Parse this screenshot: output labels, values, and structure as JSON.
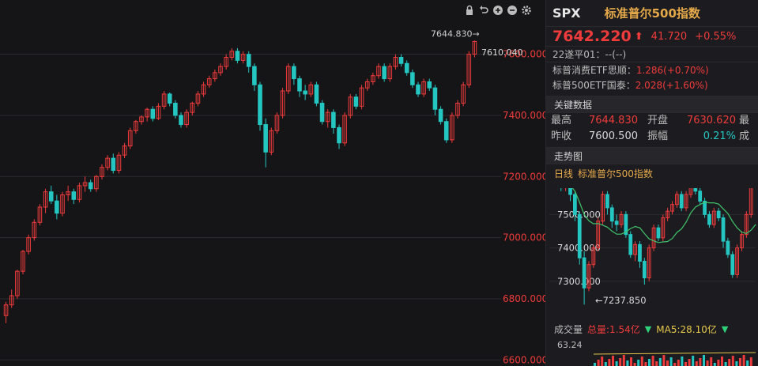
{
  "toolbar": {
    "icons": [
      "lock-icon",
      "undo-icon",
      "zoom-in-icon",
      "zoom-out-icon",
      "gear-icon"
    ]
  },
  "colors": {
    "up": "#ef3b3b",
    "down": "#25c6c1",
    "axis_text": "#ef3b3b",
    "grid": "#2c2c30",
    "ma": "#3fc46a",
    "accent": "#e6a94a"
  },
  "chart_data": [
    {
      "type": "candlestick",
      "yticks": [
        "7600.000",
        "7400.000",
        "7200.000",
        "7000.000",
        "6800.000",
        "6600.000"
      ],
      "ylim": [
        6580,
        7700
      ],
      "tick_values": [
        7600,
        7400,
        7200,
        7000,
        6800,
        6600
      ],
      "annotations": {
        "high_label": "7644.830",
        "last_label": "7610.040"
      },
      "candles": [
        [
          6745,
          6780,
          6720,
          6790
        ],
        [
          6780,
          6810,
          6770,
          6830
        ],
        [
          6810,
          6890,
          6800,
          6895
        ],
        [
          6890,
          6955,
          6880,
          6960
        ],
        [
          6955,
          7000,
          6945,
          7010
        ],
        [
          7000,
          7050,
          6990,
          7060
        ],
        [
          7050,
          7100,
          7040,
          7110
        ],
        [
          7100,
          7150,
          7080,
          7160
        ],
        [
          7150,
          7120,
          7110,
          7170
        ],
        [
          7120,
          7080,
          7060,
          7140
        ],
        [
          7080,
          7140,
          7070,
          7150
        ],
        [
          7140,
          7150,
          7120,
          7170
        ],
        [
          7150,
          7125,
          7110,
          7160
        ],
        [
          7125,
          7170,
          7115,
          7180
        ],
        [
          7170,
          7180,
          7150,
          7200
        ],
        [
          7180,
          7160,
          7150,
          7190
        ],
        [
          7160,
          7200,
          7150,
          7205
        ],
        [
          7200,
          7230,
          7190,
          7240
        ],
        [
          7230,
          7260,
          7220,
          7270
        ],
        [
          7260,
          7220,
          7210,
          7275
        ],
        [
          7220,
          7270,
          7210,
          7280
        ],
        [
          7270,
          7300,
          7260,
          7310
        ],
        [
          7300,
          7350,
          7290,
          7360
        ],
        [
          7350,
          7380,
          7340,
          7385
        ],
        [
          7380,
          7395,
          7370,
          7400
        ],
        [
          7395,
          7420,
          7380,
          7425
        ],
        [
          7420,
          7390,
          7380,
          7430
        ],
        [
          7390,
          7430,
          7385,
          7440
        ],
        [
          7430,
          7470,
          7420,
          7480
        ],
        [
          7470,
          7440,
          7430,
          7475
        ],
        [
          7440,
          7400,
          7390,
          7450
        ],
        [
          7400,
          7370,
          7360,
          7410
        ],
        [
          7370,
          7410,
          7360,
          7420
        ],
        [
          7410,
          7440,
          7400,
          7445
        ],
        [
          7440,
          7470,
          7430,
          7480
        ],
        [
          7470,
          7500,
          7460,
          7510
        ],
        [
          7500,
          7520,
          7490,
          7530
        ],
        [
          7520,
          7540,
          7510,
          7550
        ],
        [
          7540,
          7560,
          7530,
          7570
        ],
        [
          7560,
          7590,
          7550,
          7600
        ],
        [
          7590,
          7610,
          7580,
          7620
        ],
        [
          7610,
          7580,
          7570,
          7620
        ],
        [
          7580,
          7600,
          7570,
          7610
        ],
        [
          7600,
          7560,
          7540,
          7610
        ],
        [
          7560,
          7500,
          7480,
          7570
        ],
        [
          7500,
          7370,
          7350,
          7510
        ],
        [
          7370,
          7280,
          7230,
          7390
        ],
        [
          7280,
          7350,
          7270,
          7360
        ],
        [
          7350,
          7400,
          7340,
          7410
        ],
        [
          7400,
          7480,
          7390,
          7490
        ],
        [
          7480,
          7560,
          7470,
          7570
        ],
        [
          7560,
          7520,
          7500,
          7570
        ],
        [
          7520,
          7480,
          7460,
          7530
        ],
        [
          7480,
          7470,
          7450,
          7500
        ],
        [
          7470,
          7500,
          7460,
          7510
        ],
        [
          7500,
          7440,
          7430,
          7510
        ],
        [
          7440,
          7380,
          7370,
          7450
        ],
        [
          7380,
          7410,
          7360,
          7420
        ],
        [
          7410,
          7360,
          7340,
          7420
        ],
        [
          7360,
          7310,
          7290,
          7370
        ],
        [
          7310,
          7400,
          7300,
          7410
        ],
        [
          7400,
          7460,
          7390,
          7470
        ],
        [
          7460,
          7430,
          7420,
          7470
        ],
        [
          7430,
          7490,
          7420,
          7500
        ],
        [
          7490,
          7510,
          7480,
          7520
        ],
        [
          7510,
          7530,
          7500,
          7540
        ],
        [
          7530,
          7560,
          7520,
          7570
        ],
        [
          7560,
          7520,
          7510,
          7570
        ],
        [
          7520,
          7560,
          7510,
          7570
        ],
        [
          7560,
          7590,
          7550,
          7600
        ],
        [
          7590,
          7570,
          7560,
          7600
        ],
        [
          7570,
          7540,
          7530,
          7580
        ],
        [
          7540,
          7500,
          7490,
          7550
        ],
        [
          7500,
          7470,
          7460,
          7510
        ],
        [
          7470,
          7510,
          7460,
          7520
        ],
        [
          7510,
          7490,
          7480,
          7520
        ],
        [
          7490,
          7420,
          7400,
          7500
        ],
        [
          7420,
          7380,
          7370,
          7430
        ],
        [
          7380,
          7320,
          7310,
          7390
        ],
        [
          7320,
          7400,
          7310,
          7410
        ],
        [
          7400,
          7440,
          7390,
          7450
        ],
        [
          7440,
          7500,
          7430,
          7510
        ],
        [
          7500,
          7600,
          7490,
          7610
        ],
        [
          7600,
          7642,
          7590,
          7645
        ]
      ]
    },
    {
      "type": "candlestick",
      "title": "标准普尔500指数",
      "yticks": [
        "7500.000",
        "7400.000",
        "7300.000"
      ],
      "tick_values": [
        7500,
        7400,
        7300
      ],
      "ylim": [
        7200,
        7560
      ],
      "annotations": {
        "low_label": "←7237.850"
      }
    }
  ],
  "header": {
    "code": "SPX",
    "name": "标准普尔500指数"
  },
  "quote": {
    "price": "7642.220",
    "arrow": "⬆",
    "change": "41.720",
    "change_pct": "+0.55%"
  },
  "lines": {
    "l1": "22遂平01：--(--)",
    "l2_label": "标普消费ETF思顺：",
    "l2_val": "1.286(+0.70%)",
    "l3_label": "标普500ETF国泰：",
    "l3_val": "2.028(+1.60%)"
  },
  "key_data": {
    "title": "关键数据",
    "rows": [
      {
        "k1": "最高",
        "v1": "7644.830",
        "k2": "开盘",
        "v2": "7630.620",
        "k3": "最"
      },
      {
        "k1": "昨收",
        "v1": "7600.500",
        "k2": "振幅",
        "v2": "0.21%",
        "k3": "成"
      }
    ]
  },
  "trend": {
    "title": "走势图",
    "period": "日线",
    "name": "标准普尔500指数"
  },
  "volume": {
    "label": "成交量",
    "total": "总量:1.54亿",
    "ma5": "MA5:28.10亿",
    "value": "63.24"
  }
}
